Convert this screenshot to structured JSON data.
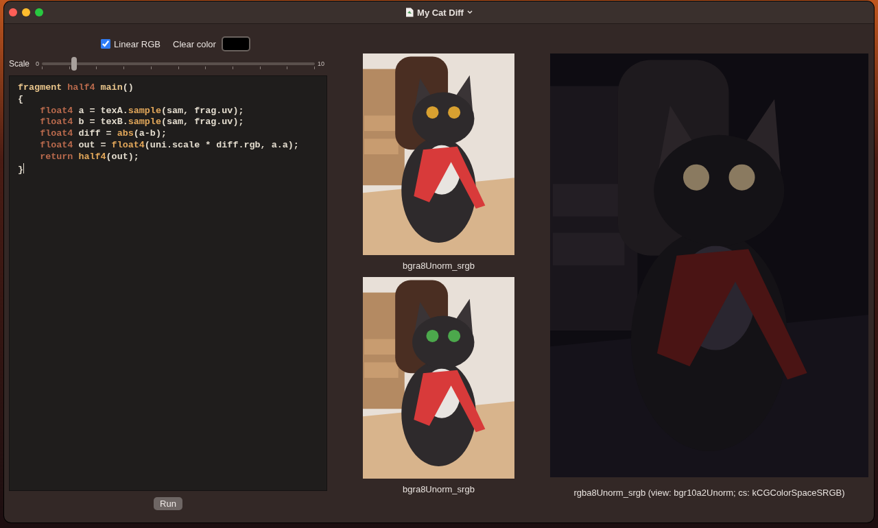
{
  "window": {
    "title": "My Cat Diff"
  },
  "options": {
    "linear_rgb": {
      "label": "Linear RGB",
      "checked": true
    },
    "clear_color": {
      "label": "Clear color"
    }
  },
  "scale": {
    "label": "Scale",
    "min_label": "0",
    "max_label": "10",
    "level": 0.11
  },
  "editor": {
    "lines": [
      [
        {
          "text": "fragment",
          "kind": "keyword"
        },
        {
          "text": " half4",
          "kind": "type"
        },
        {
          "text": " main",
          "kind": "keyword"
        },
        {
          "text": "()",
          "kind": "plain"
        }
      ],
      [
        {
          "text": "{",
          "kind": "plain"
        }
      ],
      [
        {
          "text": "    float4",
          "kind": "type"
        },
        {
          "text": " a = texA.",
          "kind": "plain"
        },
        {
          "text": "sample",
          "kind": "func"
        },
        {
          "text": "(sam, frag.uv);",
          "kind": "plain"
        }
      ],
      [
        {
          "text": "    float4",
          "kind": "type"
        },
        {
          "text": " b = texB.",
          "kind": "plain"
        },
        {
          "text": "sample",
          "kind": "func"
        },
        {
          "text": "(sam, frag.uv);",
          "kind": "plain"
        }
      ],
      [
        {
          "text": "    float4",
          "kind": "type"
        },
        {
          "text": " diff = ",
          "kind": "plain"
        },
        {
          "text": "abs",
          "kind": "func"
        },
        {
          "text": "(a-b);",
          "kind": "plain"
        }
      ],
      [
        {
          "text": "    float4",
          "kind": "type"
        },
        {
          "text": " out = ",
          "kind": "plain"
        },
        {
          "text": "float4",
          "kind": "func"
        },
        {
          "text": "(uni.scale * diff.rgb, a.a);",
          "kind": "plain"
        }
      ],
      [
        {
          "text": "    return",
          "kind": "type"
        },
        {
          "text": " half4",
          "kind": "func"
        },
        {
          "text": "(out);",
          "kind": "plain"
        }
      ],
      [
        {
          "text": "}",
          "kind": "plain"
        }
      ]
    ]
  },
  "run_button": "Run",
  "source_images": [
    {
      "caption": "bgra8Unorm_srgb"
    },
    {
      "caption": "bgra8Unorm_srgb"
    }
  ],
  "result_image": {
    "caption": "rgba8Unorm_srgb (view: bgr10a2Unorm; cs: kCGColorSpaceSRGB)"
  }
}
